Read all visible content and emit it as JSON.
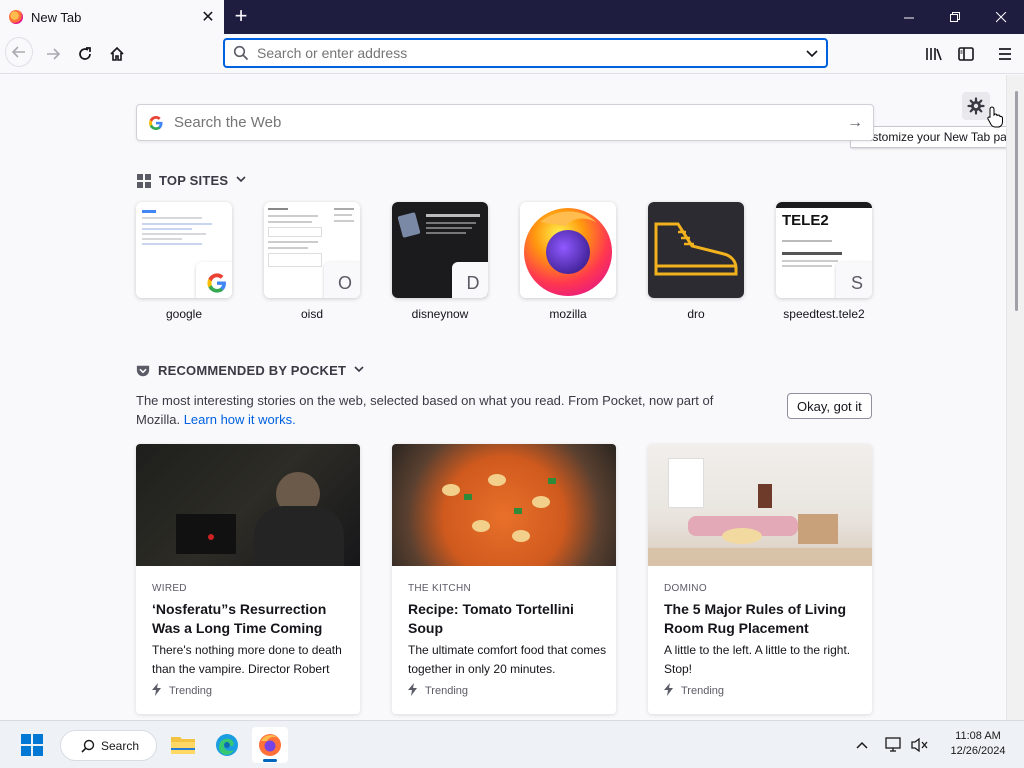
{
  "browser": {
    "tab": {
      "title": "New Tab",
      "close_glyph": "✕"
    },
    "new_tab_glyph": "+",
    "window_controls": {
      "minimize": "—",
      "restore": "❐",
      "close": "✕"
    },
    "urlbar": {
      "placeholder": "Search or enter address"
    }
  },
  "newtab": {
    "search": {
      "engine_glyph": "G",
      "placeholder": "Search the Web",
      "submit_glyph": "→"
    },
    "customize_tooltip": "Customize your New Tab page",
    "top_sites": {
      "title": "TOP SITES",
      "sites": [
        {
          "label": "google",
          "badge": ""
        },
        {
          "label": "oisd",
          "badge": "O"
        },
        {
          "label": "disneynow",
          "badge": "D"
        },
        {
          "label": "mozilla",
          "badge": ""
        },
        {
          "label": "dro",
          "badge": ""
        },
        {
          "label": "speedtest.tele2",
          "badge": "S"
        }
      ]
    },
    "pocket": {
      "title": "RECOMMENDED BY POCKET",
      "description": "The most interesting stories on the web, selected based on what you read. From Pocket, now part of Mozilla.",
      "learn_link": "Learn how it works.",
      "dismiss_button": "Okay, got it",
      "cards": [
        {
          "source": "WIRED",
          "headline": "‘Nosferatu”s Resurrection Was a Long Time Coming",
          "excerpt": "There's nothing more done to death than the vampire. Director Robert",
          "trend": "Trending"
        },
        {
          "source": "THE KITCHN",
          "headline": "Recipe: Tomato Tortellini Soup",
          "excerpt": "The ultimate comfort food that comes together in only 20 minutes.",
          "trend": "Trending"
        },
        {
          "source": "DOMINO",
          "headline": "The 5 Major Rules of Living Room Rug Placement",
          "excerpt": "A little to the left. A little to the right. Stop!",
          "trend": "Trending"
        }
      ]
    }
  },
  "taskbar": {
    "search_label": "Search",
    "time": "11:08 AM",
    "date": "12/26/2024"
  },
  "colors": {
    "accent": "#0061e0",
    "tabstrip": "#1f1d3f"
  }
}
